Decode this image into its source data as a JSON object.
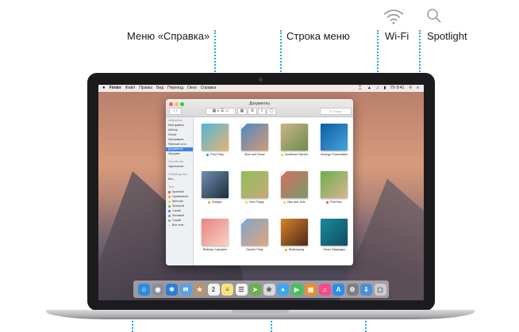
{
  "callouts": {
    "help_menu": "Меню «Справка»",
    "menu_bar": "Строка меню",
    "wifi": "Wi-Fi",
    "spotlight": "Spotlight"
  },
  "menubar": {
    "app": "Finder",
    "items": [
      "Файл",
      "Правка",
      "Вид",
      "Переход",
      "Окно",
      "Справка"
    ],
    "clock": "Пт 9:41"
  },
  "finder": {
    "title": "Документы",
    "search_placeholder": "Поиск",
    "sidebar": {
      "favorites_header": "Избранное",
      "favorites": [
        "Мои файлы",
        "AirDrop",
        "iCloud",
        "Программы",
        "Рабочий стол",
        "Документы",
        "Загрузки"
      ],
      "devices_header": "Устройства",
      "devices": [
        "Удаленный..."
      ],
      "shared_header": "Общий доступ",
      "shared": [
        "Все..."
      ],
      "tags_header": "Теги",
      "tags": [
        {
          "label": "Красный",
          "color": "#e5483f"
        },
        {
          "label": "Оранжевый",
          "color": "#f29b2c"
        },
        {
          "label": "Желтый",
          "color": "#f2d03a"
        },
        {
          "label": "Зеленый",
          "color": "#5cc04a"
        },
        {
          "label": "Синий",
          "color": "#3b86e3"
        },
        {
          "label": "Лиловый",
          "color": "#b06ad6"
        },
        {
          "label": "Серый",
          "color": "#9a9a9a"
        },
        {
          "label": "Все теги...",
          "color": "#dddddd"
        }
      ]
    },
    "documents": [
      {
        "name": "Pool Party",
        "tag": "#3b86e3"
      },
      {
        "name": "Mom and Oscar",
        "tag": ""
      },
      {
        "name": "Southtown Garden",
        "tag": "#f2d03a"
      },
      {
        "name": "Geology Presentation",
        "tag": ""
      },
      {
        "name": "Bridges",
        "tag": "#f29b2c"
      },
      {
        "name": "New Puppy",
        "tag": "#f2d03a"
      },
      {
        "name": "Max and Julie",
        "tag": "#f2d03a"
      },
      {
        "name": "First Kiss",
        "tag": "#e5483f"
      },
      {
        "name": "Birthday Cupcakes",
        "tag": ""
      },
      {
        "name": "Sarah's Party",
        "tag": ""
      },
      {
        "name": "Beekeeping",
        "tag": "#f29b2c"
      },
      {
        "name": "Travel Galapagos",
        "tag": ""
      }
    ]
  },
  "dock_apps": [
    "finder-icon",
    "launchpad-icon",
    "safari-icon",
    "mail-icon",
    "contacts-icon",
    "calendar-icon",
    "notes-icon",
    "reminders-icon",
    "maps-icon",
    "photos-icon",
    "messages-icon",
    "facetime-icon",
    "ibooks-icon",
    "itunes-icon",
    "app-store-icon",
    "system-preferences-icon",
    "downloads-stack-icon",
    "trash-icon"
  ],
  "colors": {
    "callout_line": "#2aa4d8",
    "selection": "#3b82e6"
  }
}
